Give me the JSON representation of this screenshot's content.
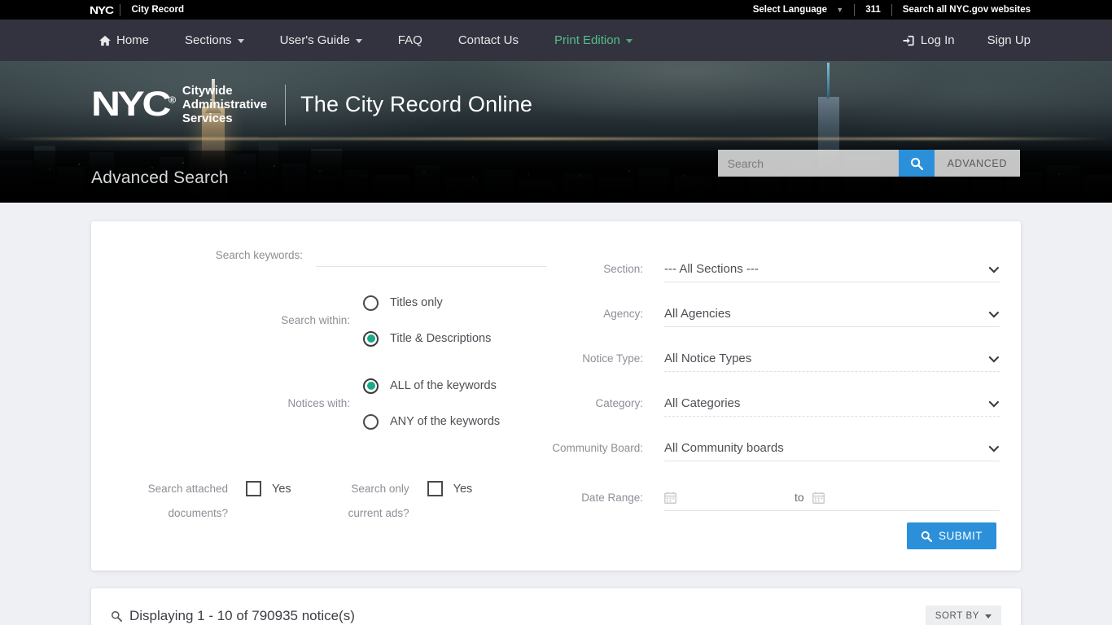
{
  "utility_bar": {
    "logo": "NYC",
    "site_label": "City Record",
    "language_label": "Select Language",
    "phone": "311",
    "search_all": "Search all NYC.gov websites"
  },
  "main_nav": {
    "items": [
      {
        "label": "Home",
        "icon": "home-icon",
        "caret": false
      },
      {
        "label": "Sections",
        "caret": true
      },
      {
        "label": "User's Guide",
        "caret": true
      },
      {
        "label": "FAQ",
        "caret": false
      },
      {
        "label": "Contact Us",
        "caret": false
      },
      {
        "label": "Print Edition",
        "caret": true,
        "color": "#52bf8c"
      }
    ],
    "login_label": "Log In",
    "signup_label": "Sign Up"
  },
  "hero": {
    "brand_nyc": "NYC",
    "brand_sup": "®",
    "brand_agency_line1": "Citywide",
    "brand_agency_line2": "Administrative",
    "brand_agency_line3": "Services",
    "site_title": "The City Record Online",
    "search_placeholder": "Search",
    "search_value": "",
    "advanced_label": "ADVANCED",
    "page_title": "Advanced Search"
  },
  "form": {
    "keywords": {
      "label": "Search keywords:",
      "value": "",
      "placeholder": ""
    },
    "search_within": {
      "label": "Search within:",
      "options": [
        {
          "label": "Titles only",
          "selected": false
        },
        {
          "label": "Title & Descriptions",
          "selected": true
        }
      ]
    },
    "notices_with": {
      "label": "Notices with:",
      "options": [
        {
          "label": "ALL of the keywords",
          "selected": true
        },
        {
          "label": "ANY of the keywords",
          "selected": false
        }
      ]
    },
    "attached_docs": {
      "label_line1": "Search attached",
      "label_line2": "documents?",
      "checkbox_label": "Yes",
      "checked": false
    },
    "current_ads": {
      "label_line1": "Search only",
      "label_line2": "current ads?",
      "checkbox_label": "Yes",
      "checked": false
    },
    "selects": [
      {
        "label": "Section:",
        "value": "--- All Sections ---",
        "style": "solid"
      },
      {
        "label": "Agency:",
        "value": "All Agencies",
        "style": "solid"
      },
      {
        "label": "Notice Type:",
        "value": "All Notice Types",
        "style": "dotted"
      },
      {
        "label": "Category:",
        "value": "All Categories",
        "style": "dotted"
      },
      {
        "label": "Community Board:",
        "value": "All Community boards",
        "style": "solid"
      }
    ],
    "date_range": {
      "label": "Date Range:",
      "from_value": "",
      "to_label": "to",
      "to_value": ""
    },
    "submit_label": "SUBMIT"
  },
  "results": {
    "summary": "Displaying 1 - 10 of 790935 notice(s)",
    "sort_by_label": "SORT BY"
  },
  "colors": {
    "accent_blue": "#2b90d9",
    "accent_green": "#52bf8c",
    "radio_teal": "#1aa98a",
    "nav_bg": "#33333f",
    "page_bg": "#eef0f4"
  }
}
